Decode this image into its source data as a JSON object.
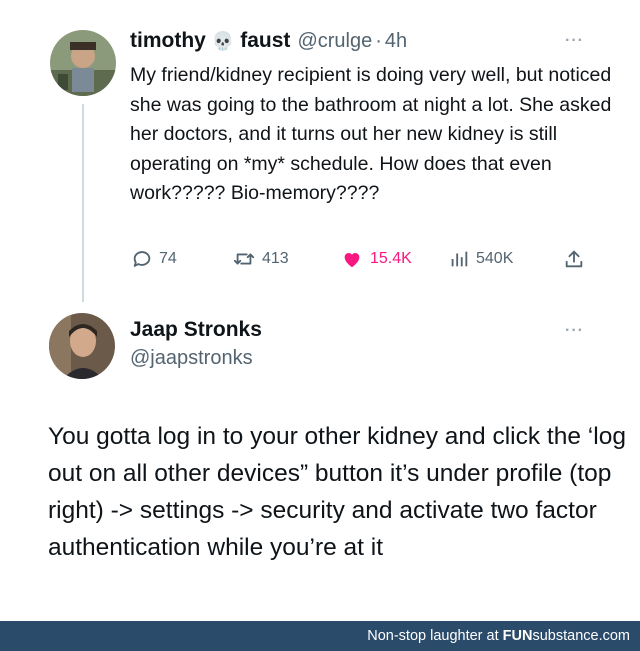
{
  "tweet1": {
    "display_name_first": "timothy",
    "display_name_emoji": "💀",
    "display_name_last": "faust",
    "handle": "@crulge",
    "separator": "·",
    "time": "4h",
    "more": "···",
    "text": "My friend/kidney recipient is doing very well, but noticed she was going to the bathroom at night a lot. She asked her doctors, and it turns out her new kidney is still operating on *my* schedule. How does that even work????? Bio-memory????",
    "replies": "74",
    "retweets": "413",
    "likes": "15.4K",
    "views": "540K",
    "like_color": "#f91880"
  },
  "tweet2": {
    "display_name": "Jaap Stronks",
    "handle": "@jaapstronks",
    "more": "···",
    "text": "You gotta log in to your other kidney and click the ‘log out on all other devices” button it’s under profile (top right) -> settings -> security and activate two factor authentication while you’re at it"
  },
  "footer": {
    "prefix": "Non-stop laughter at ",
    "brand_bold": "FUN",
    "brand_rest": "substance",
    "brand_suffix": ".com",
    "background": "#2a4b6a"
  }
}
